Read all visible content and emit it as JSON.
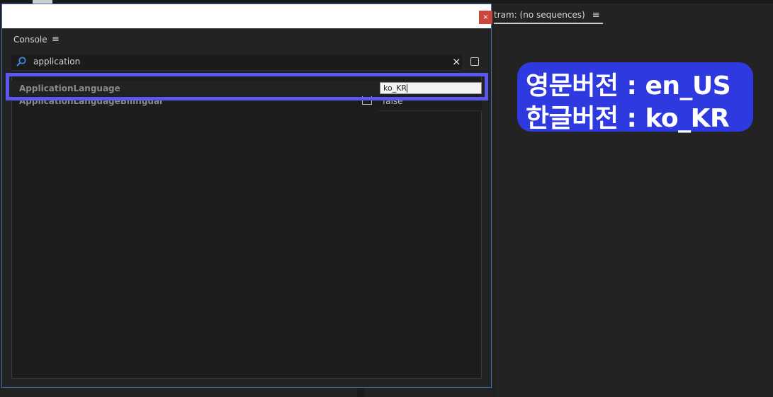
{
  "monitor": {
    "title": "tram: (no sequences)",
    "menu_glyph": "≡"
  },
  "dialog": {
    "close_glyph": "×"
  },
  "console": {
    "title": "Console",
    "menu_glyph": "≡",
    "search_value": "application",
    "clear_glyph": "×"
  },
  "rows": [
    {
      "key": "ApplicationLanguage",
      "value": "ko_KR"
    },
    {
      "key": "ApplicationLanguageBilingual",
      "value": "false"
    }
  ],
  "annotation": {
    "line1": "영문버전 : en_US",
    "line2": "한글버전 : ko_KR",
    "highlight_color": "#5a58f0",
    "bubble_color": "#2e3ae0"
  }
}
